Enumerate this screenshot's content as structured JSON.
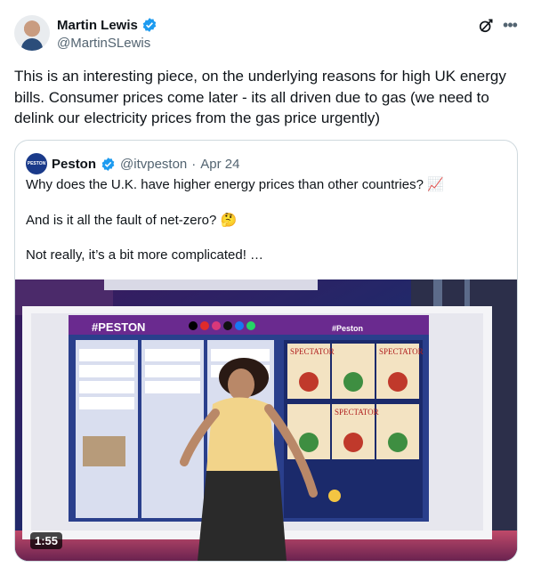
{
  "author": {
    "display_name": "Martin Lewis",
    "handle": "@MartinSLewis"
  },
  "tweet": {
    "text": "This is an interesting piece, on the underlying reasons for high UK energy bills.  Consumer prices come later - its all driven due to gas (we need to delink our electricity prices from the gas price urgently)"
  },
  "quote": {
    "display_name": "Peston",
    "handle": "@itvpeston",
    "separator": "·",
    "date": "Apr 24",
    "avatar_label": "PESTON",
    "line1": "Why does the U.K. have higher energy prices than other countries? 📈",
    "line2": "And is it all the fault of net-zero? 🤔",
    "line3": "Not really, it’s a bit more complicated! …",
    "video": {
      "duration": "1:55",
      "studio_board_title": "#PESTON",
      "board_panel_title": "#Peston",
      "magazine_titles": [
        "SPECTATOR",
        "SPECTATOR",
        "SPECTATOR",
        "SPECTATOR"
      ]
    }
  },
  "colors": {
    "verified": "#1d9bf0",
    "text": "#0f1419",
    "muted": "#536471",
    "border": "#cfd9de",
    "studio_purple": "#6a2a8f",
    "studio_blue": "#2a3f8c"
  },
  "icons": {
    "verified": "verified-badge-icon",
    "grok": "grok-icon",
    "more": "more-dots-icon"
  }
}
